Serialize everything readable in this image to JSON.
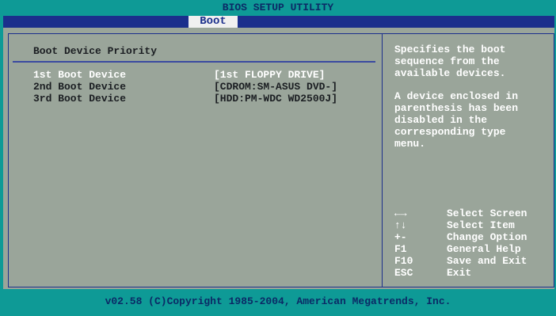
{
  "title": "BIOS SETUP UTILITY",
  "active_tab": "Boot",
  "section_title": "Boot Device Priority",
  "boot_devices": [
    {
      "label": "1st Boot Device",
      "value": "[1st FLOPPY DRIVE]"
    },
    {
      "label": "2nd Boot Device",
      "value": "[CDROM:SM-ASUS DVD-]"
    },
    {
      "label": "3rd Boot Device",
      "value": "[HDD:PM-WDC WD2500J]"
    }
  ],
  "help_text_1": [
    "Specifies the boot",
    "sequence from the",
    "available devices."
  ],
  "help_text_2": [
    "A device enclosed in",
    "parenthesis has been",
    "disabled in the",
    "corresponding type",
    "menu."
  ],
  "keys": [
    {
      "key": "←→",
      "action": "Select Screen"
    },
    {
      "key": "↑↓",
      "action": "Select Item"
    },
    {
      "key": "+-",
      "action": "Change Option"
    },
    {
      "key": "F1",
      "action": "General Help"
    },
    {
      "key": "F10",
      "action": "Save and Exit"
    },
    {
      "key": "ESC",
      "action": "Exit"
    }
  ],
  "footer": "v02.58 (C)Copyright 1985-2004, American Megatrends, Inc.",
  "colors": {
    "background": "#0e9a96",
    "panel": "#9aa59a",
    "tabbar": "#1b2f8c",
    "highlight": "#ffffff"
  }
}
